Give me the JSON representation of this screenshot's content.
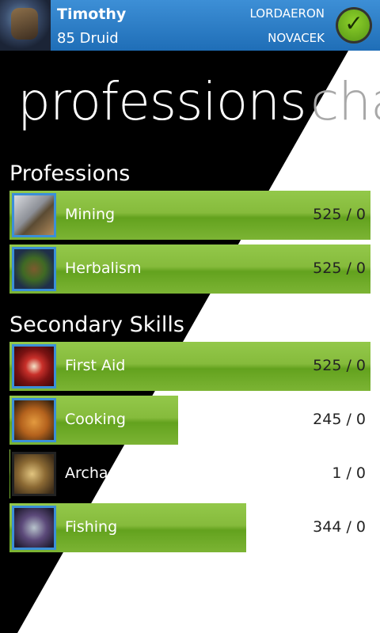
{
  "header": {
    "character_name": "Timothy",
    "character_level_class": "85 Druid",
    "realm": "LORDAERON",
    "guild": "NOVACEK"
  },
  "panorama": {
    "title": "professions",
    "next_title": "cha"
  },
  "sections": {
    "primary_heading": "Professions",
    "secondary_heading": "Secondary Skills"
  },
  "professions": [
    {
      "name": "Mining",
      "value": "525 / 0",
      "progress": 1.0,
      "icon": "mining-pick-icon"
    },
    {
      "name": "Herbalism",
      "value": "525 / 0",
      "progress": 1.0,
      "icon": "herbalism-leaf-icon"
    }
  ],
  "secondary_skills": [
    {
      "name": "First Aid",
      "value": "525 / 0",
      "progress": 1.0,
      "icon": "first-aid-icon"
    },
    {
      "name": "Cooking",
      "value": "245 / 0",
      "progress": 0.467,
      "icon": "cooking-turkey-icon"
    },
    {
      "name": "Archaeology",
      "value": "1 / 0",
      "progress": 0.002,
      "icon": "archaeology-icon"
    },
    {
      "name": "Fishing",
      "value": "344 / 0",
      "progress": 0.655,
      "icon": "fishing-hook-icon"
    }
  ],
  "colors": {
    "header_blue": "#2a7fcf",
    "progress_green": "#7cb434",
    "icon_border_blue": "#3b8fd8"
  }
}
